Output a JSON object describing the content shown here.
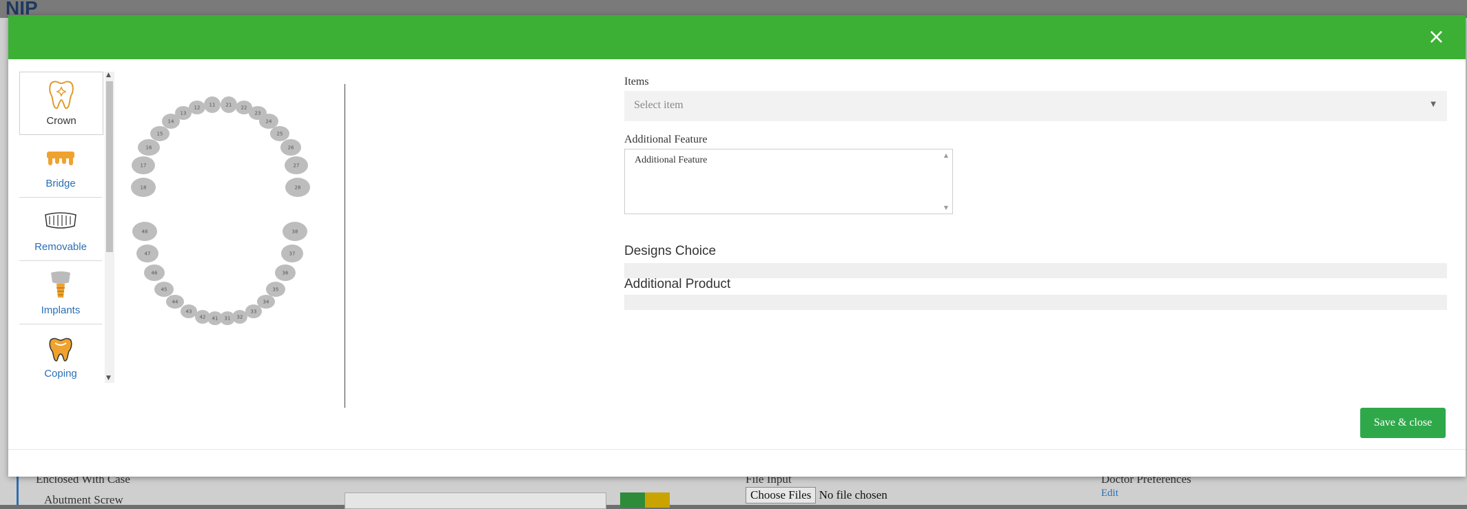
{
  "background": {
    "logo": "NIP",
    "enclosed_label": "Enclosed With Case",
    "abutment_label": "Abutment Screw",
    "file_import_label": "File Input",
    "choose_files": "Choose Files",
    "no_file": "No file chosen",
    "doctor_pref_label": "Doctor Preferences",
    "edit_link": "Edit"
  },
  "modal": {
    "close_label": "×",
    "categories": [
      {
        "label": "Crown",
        "icon": "crown-icon",
        "selected": true
      },
      {
        "label": "Bridge",
        "icon": "bridge-icon",
        "selected": false
      },
      {
        "label": "Removable",
        "icon": "removable-icon",
        "selected": false
      },
      {
        "label": "Implants",
        "icon": "implant-icon",
        "selected": false
      },
      {
        "label": "Coping",
        "icon": "coping-icon",
        "selected": false
      }
    ],
    "teeth_upper": [
      "18",
      "17",
      "16",
      "15",
      "14",
      "13",
      "12",
      "11",
      "21",
      "22",
      "23",
      "24",
      "25",
      "26",
      "27",
      "28"
    ],
    "teeth_lower": [
      "48",
      "47",
      "46",
      "45",
      "44",
      "43",
      "42",
      "41",
      "31",
      "32",
      "33",
      "34",
      "35",
      "36",
      "37",
      "38"
    ],
    "items_label": "Items",
    "items_placeholder": "Select item",
    "additional_feature_label": "Additional Feature",
    "additional_feature_value": "Additional Feature",
    "designs_choice_label": "Designs Choice",
    "additional_product_label": "Additional Product",
    "save_label": "Save & close"
  },
  "colors": {
    "header_green": "#3cb035",
    "save_green": "#2fa84a",
    "link_blue": "#2a6fb5",
    "tooth_gray": "#bdbdbd"
  }
}
